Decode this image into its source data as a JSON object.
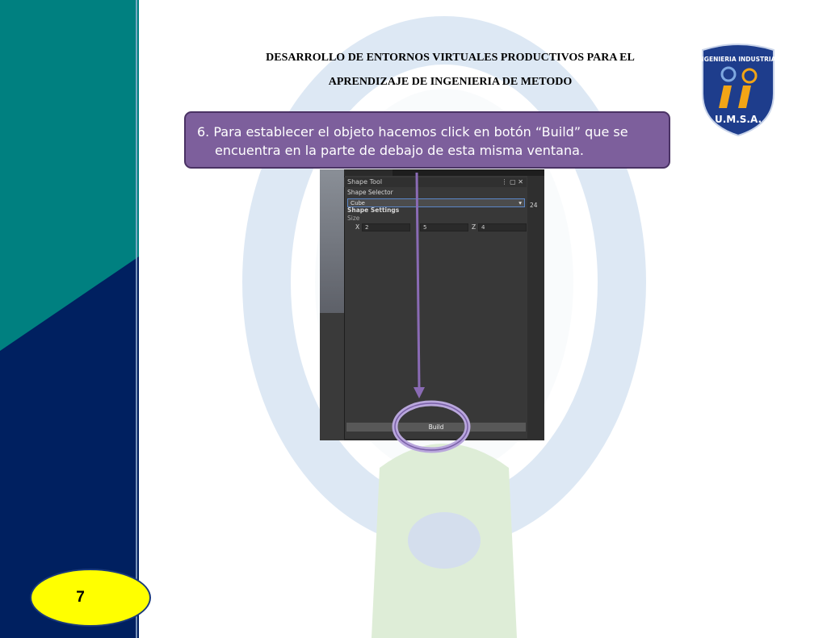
{
  "header": {
    "title_line1": "DESARROLLO DE ENTORNOS VIRTUALES PRODUCTIVOS PARA EL",
    "title_line2": "APRENDIZAJE  DE INGENIERIA DE METODO"
  },
  "logo": {
    "top_text": "INGENIERIA INDUSTRIAL",
    "bottom_text": "U.M.S.A."
  },
  "callout": {
    "line1": "6. Para establecer el objeto hacemos click en botón “Build” que se",
    "line2": "encuentra en la parte de debajo de esta misma ventana."
  },
  "screenshot": {
    "tab_label": "Shape Tool",
    "shape_selector_label": "Shape Selector",
    "selected_shape": "Cube",
    "shape_settings_label": "Shape Settings",
    "size_label": "Size",
    "x_label": "X",
    "x_value": "2",
    "y_value": "5",
    "z_label": "Z",
    "z_value": "4",
    "side_value": "24",
    "build_label": "Build"
  },
  "page_number": "7",
  "colors": {
    "teal": "#008080",
    "navy": "#002060",
    "callout": "#7d5f9c",
    "arrow": "#8a6bb5",
    "page_badge": "#ffff00"
  }
}
